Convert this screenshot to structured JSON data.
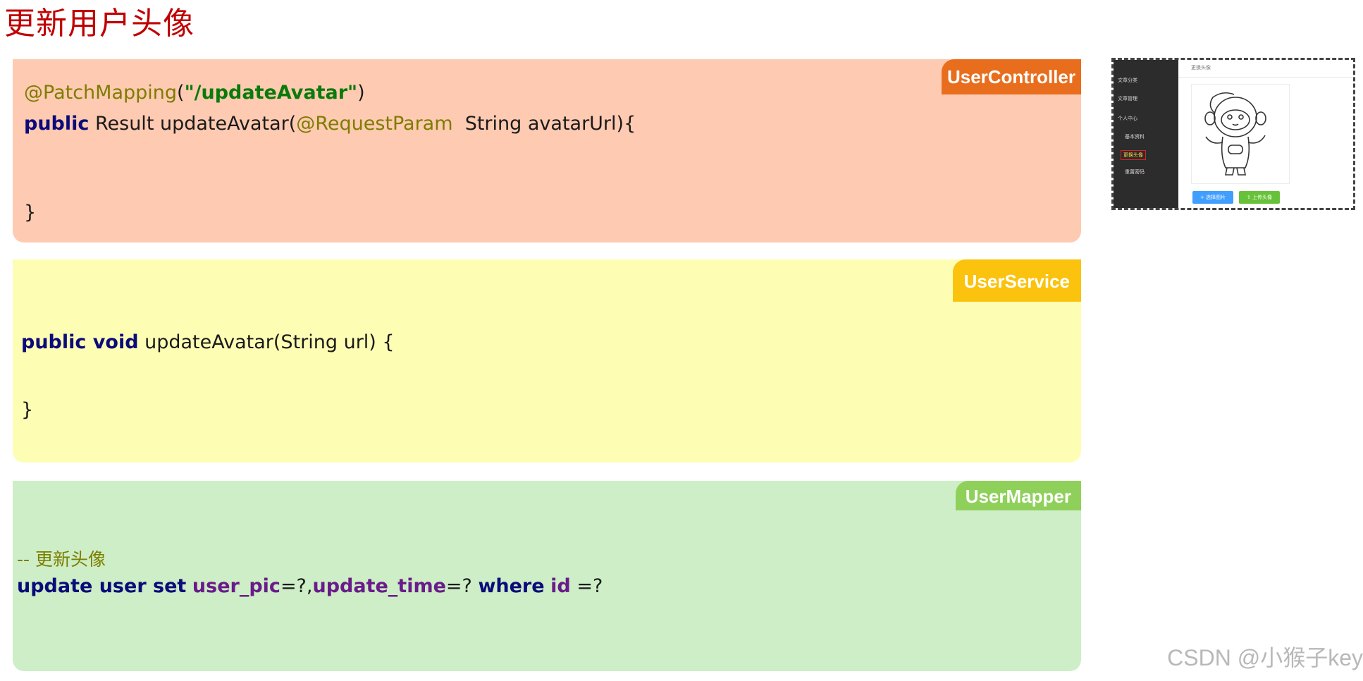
{
  "title": "更新用户头像",
  "controller": {
    "tag": "UserController",
    "line1_annotation": "@PatchMapping",
    "line1_open": "(",
    "line1_string": "\"/updateAvatar\"",
    "line1_close": ")",
    "line2_kw": "public",
    "line2_a": " Result updateAvatar(",
    "line2_annotation": "@RequestParam",
    "line2_b": "  String avatarUrl){",
    "close_brace": "}"
  },
  "service": {
    "tag": "UserService",
    "line1_kw": "public void",
    "line1_rest": " updateAvatar(String url) {",
    "close_brace": "}"
  },
  "mapper": {
    "tag": "UserMapper",
    "comment": "-- 更新头像",
    "kw_update": "update user set",
    "field_user_pic": "user_pic",
    "eq1": "=?,",
    "field_update_time": "update_time",
    "eq2": "=? ",
    "kw_where": "where",
    "field_id": "id",
    "eq3": " =?"
  },
  "thumbnail": {
    "header": "更换头像",
    "menu": [
      "文章分类",
      "文章管理",
      "个人中心",
      "基本资料",
      "更换头像",
      "重置密码"
    ],
    "btn_select": "+ 选择图片",
    "btn_upload": "⇪ 上传头像"
  },
  "watermark": "CSDN @小猴子key"
}
